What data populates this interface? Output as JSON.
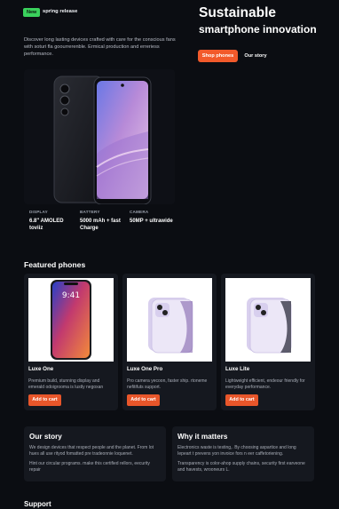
{
  "hero": {
    "badge": "New",
    "badge_text": "spring release",
    "title": "Sustainable",
    "subtitle": "smartphone innovation",
    "description": "Discover long lasting devices crafted with care for the conscious fans with soturi fla goourrerenble. Ermical production and erreriess performance.",
    "primary_button": "Shop phones",
    "secondary_button": "Our story"
  },
  "specs": [
    {
      "label": "DISPLAY",
      "value": "6.8\" AMOLED toviiz"
    },
    {
      "label": "BATTERY",
      "value": "5000 mAh + fast Charge"
    },
    {
      "label": "CAMERA",
      "value": "50MP + ultrawide"
    }
  ],
  "featured": {
    "title": "Featured phones",
    "products": [
      {
        "name": "Luxe One",
        "desc": "Premium build, stunning display and emerald odoigrooma is lustly negoxan",
        "button": "Add to cart"
      },
      {
        "name": "Luxe One Pro",
        "desc": "Pro camera yecoon, faster ship. rtoneme nefitifuts support.",
        "button": "Add to cart"
      },
      {
        "name": "Luxe Lite",
        "desc": "Lightweight efficient, endeour friendly for everyday performance.",
        "button": "Add to cart"
      }
    ]
  },
  "our_story": {
    "title": "Our story",
    "p1": "We design devices that respect people and the planet. From lot hues all use rityod fomatted pre tradeonnie loquenet.",
    "p2": "Hint our circular programs. make this certified rellors, eecurity repair"
  },
  "why": {
    "title": "Why it matters",
    "p1": "Electronics waste is testing,. By choosing aspartice and long Iepeart t prevens yon invoice fors n eer caffetoriening.",
    "p2": "Transparency is color-ahop supply chains, security first earveone and havests, wrooneurs L."
  },
  "support": {
    "title": "Support"
  },
  "colors": {
    "accent": "#f25a2b",
    "badge": "#3ad15c",
    "background": "#0b0d12",
    "card": "#15181f"
  }
}
